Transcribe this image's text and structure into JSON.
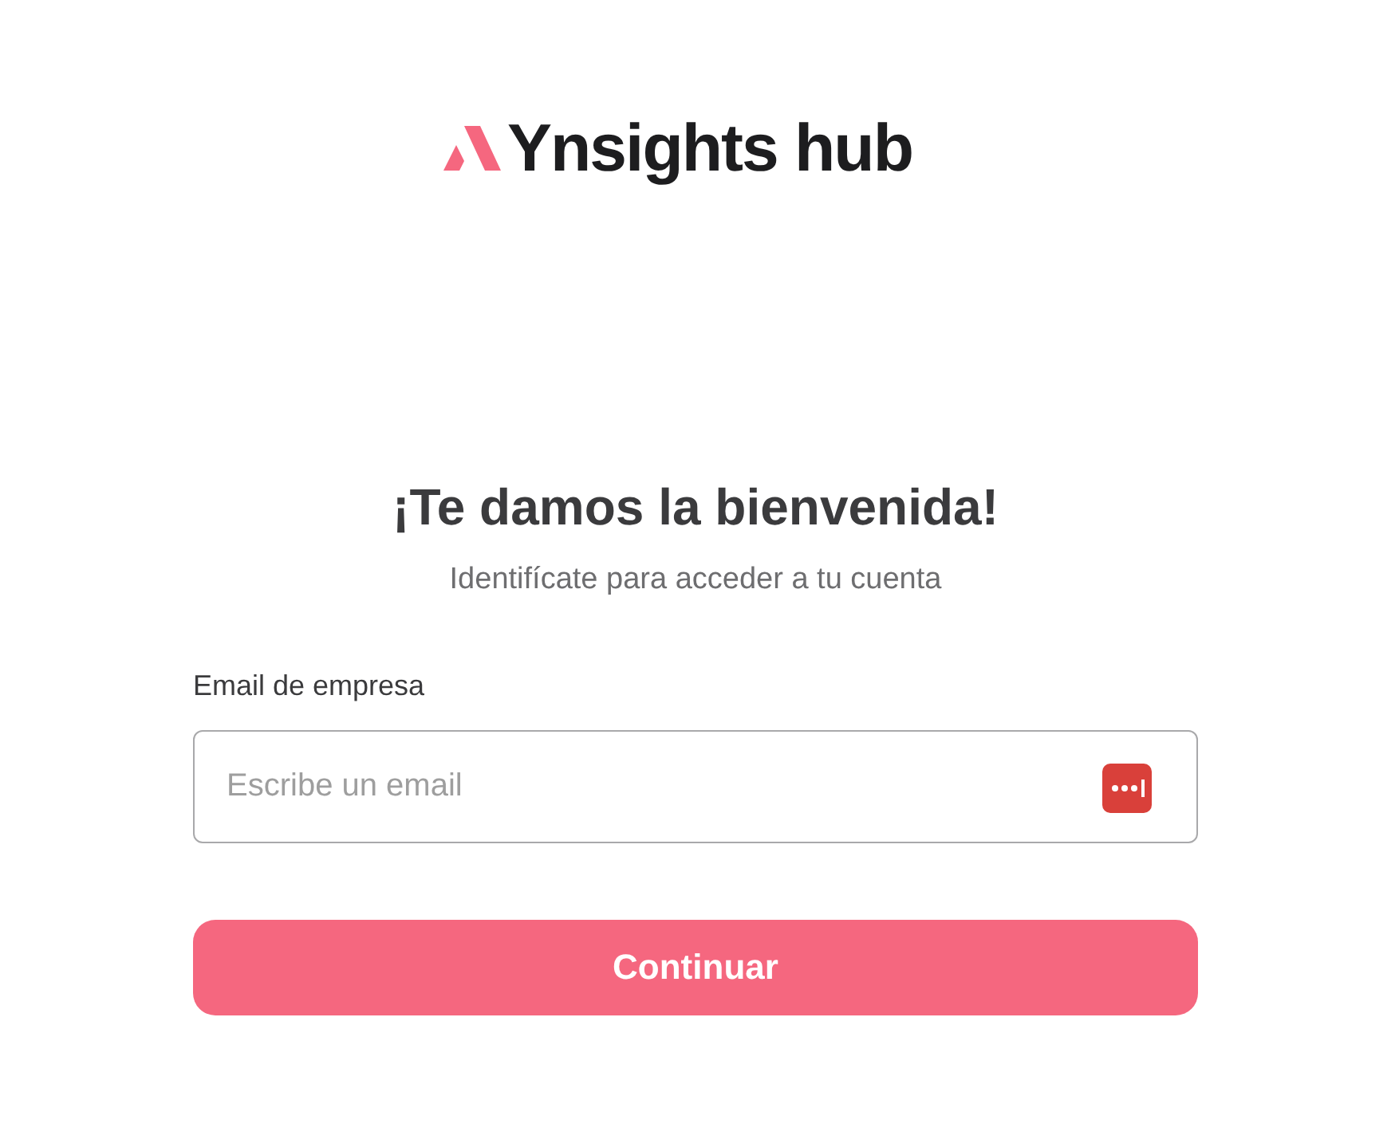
{
  "logo": {
    "text": "Ynsights hub"
  },
  "heading": "¡Te damos la bienvenida!",
  "subtitle": "Identifícate para acceder a tu cuenta",
  "email_field": {
    "label": "Email de empresa",
    "placeholder": "Escribe un email"
  },
  "button": {
    "label": "Continuar"
  }
}
